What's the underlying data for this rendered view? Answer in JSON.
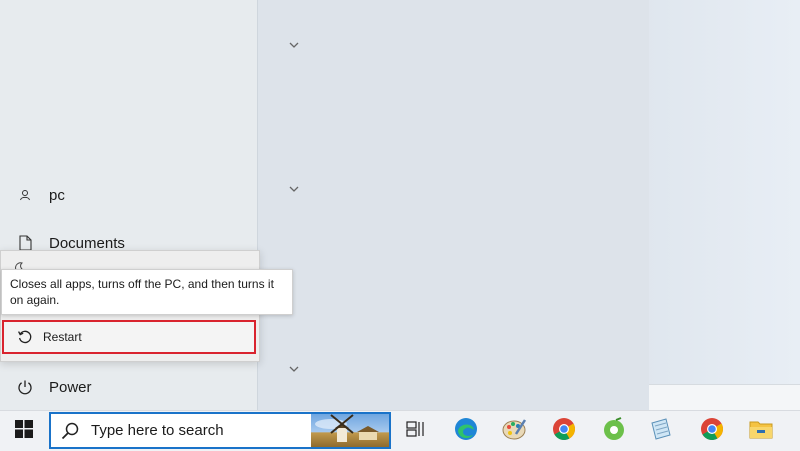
{
  "start_menu": {
    "nav": {
      "user_label": "pc",
      "documents_label": "Documents",
      "power_label": "Power"
    },
    "power_flyout": {
      "tooltip_text": "Closes all apps, turns off the PC, and then turns it on again.",
      "restart_label": "Restart"
    },
    "group_chevrons": [
      "v",
      "v",
      "v"
    ]
  },
  "taskbar": {
    "search_placeholder": "Type here to search",
    "pinned_icons": [
      "task-view-icon",
      "edge-icon",
      "paint-icon",
      "chrome-icon",
      "coccoc-icon",
      "notepad-icon",
      "chrome-icon",
      "file-explorer-icon"
    ]
  },
  "colors": {
    "highlight_border": "#d9232e",
    "search_border": "#1a73c9"
  }
}
